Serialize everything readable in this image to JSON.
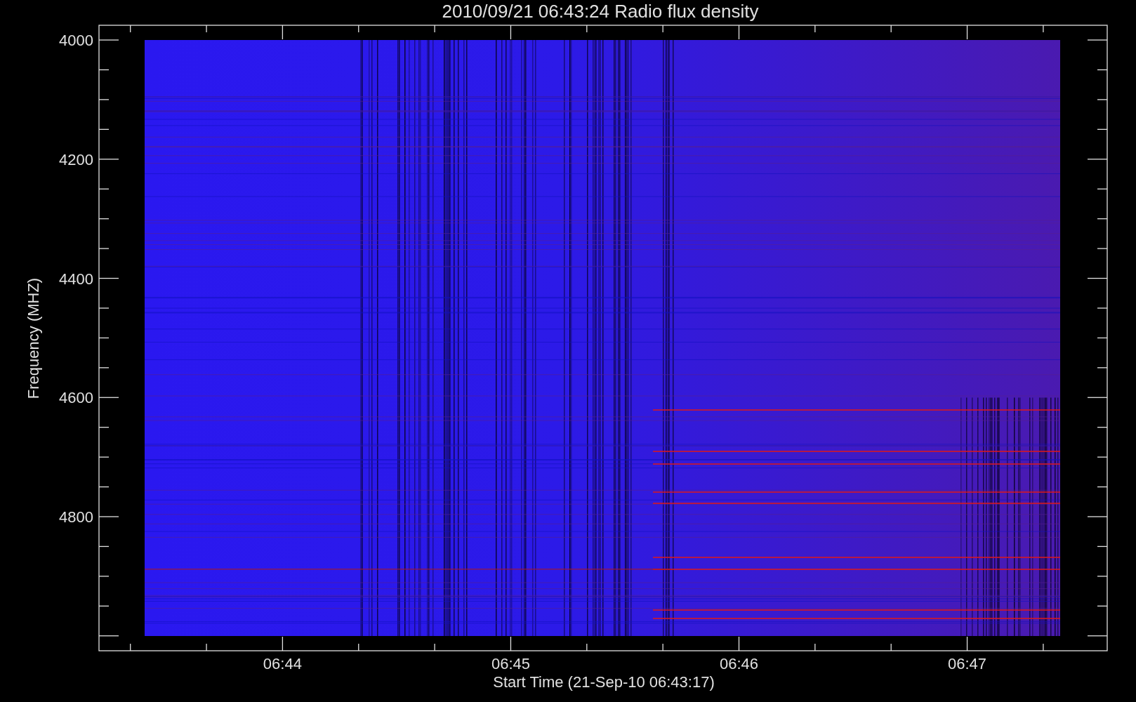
{
  "plot": {
    "title": "2010/09/21 06:43:24 Radio flux density",
    "ylabel": "Frequency (MHZ)",
    "xlabel": "Start Time (21-Sep-10 06:43:17)",
    "yticks": [
      "4000",
      "4200",
      "4400",
      "4600",
      "4800"
    ],
    "xticks": [
      "06:44",
      "06:45",
      "06:46",
      "06:47"
    ]
  }
}
